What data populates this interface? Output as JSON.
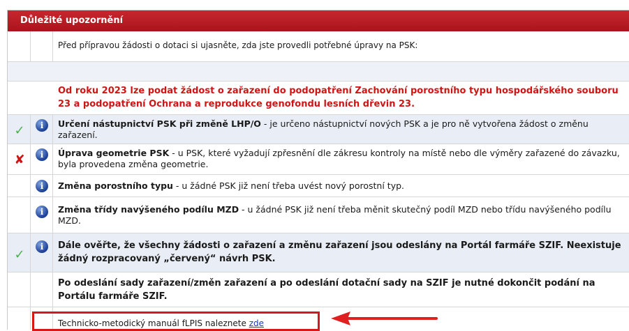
{
  "panel": {
    "title": "Důležité upozornění",
    "intro": "Před přípravou žádosti o dotaci si ujasněte, zda jste provedli potřebné úpravy na PSK:",
    "notice": "Od roku 2023 lze podat žádost o zařazení do podopatření Zachování porostního typu hospodářského souboru 23 a podopatření Ochrana a reprodukce genofondu lesních dřevin 23.",
    "items": [
      {
        "status": "check",
        "title": "Určení nástupnictví PSK při změně LHP/O",
        "text": " - je určeno nástupnictví nových PSK a je pro ně vytvořena žádost o změnu zařazení."
      },
      {
        "status": "cross",
        "title": "Úprava geometrie PSK",
        "text": " - u PSK, které vyžadují zpřesnění dle zákresu kontroly na místě nebo dle výměry zařazené do závazku, byla provedena změna geometrie."
      },
      {
        "status": "none",
        "title": "Změna porostního typu",
        "text": " - u žádné PSK již není třeba uvést nový porostní typ."
      },
      {
        "status": "none",
        "title": "Změna třídy navýšeného podílu MZD",
        "text": " - u žádné PSK již není třeba měnit skutečný podíl MZD nebo třídu navýšeného podílu MZD."
      }
    ],
    "verify": "Dále ověřte, že všechny žádosti o zařazení a změnu zařazení jsou odeslány na Portál farmáře SZIF. Neexistuje žádný rozpracovaný „červený“ návrh PSK.",
    "final": "Po odeslání sady zařazení/změn zařazení a po odeslání dotační sady na SZIF je nutné dokončit podání na Portálu farmáře SZIF.",
    "manual_text": "Technicko-metodický manuál fLPIS naleznete ",
    "manual_link": "zde"
  },
  "icons": {
    "info": "info-icon",
    "check": "check-icon",
    "cross": "cross-icon"
  },
  "colors": {
    "header": "#b51a22",
    "notice": "#d21414",
    "link": "#1a37b8",
    "highlight": "#d81818"
  }
}
